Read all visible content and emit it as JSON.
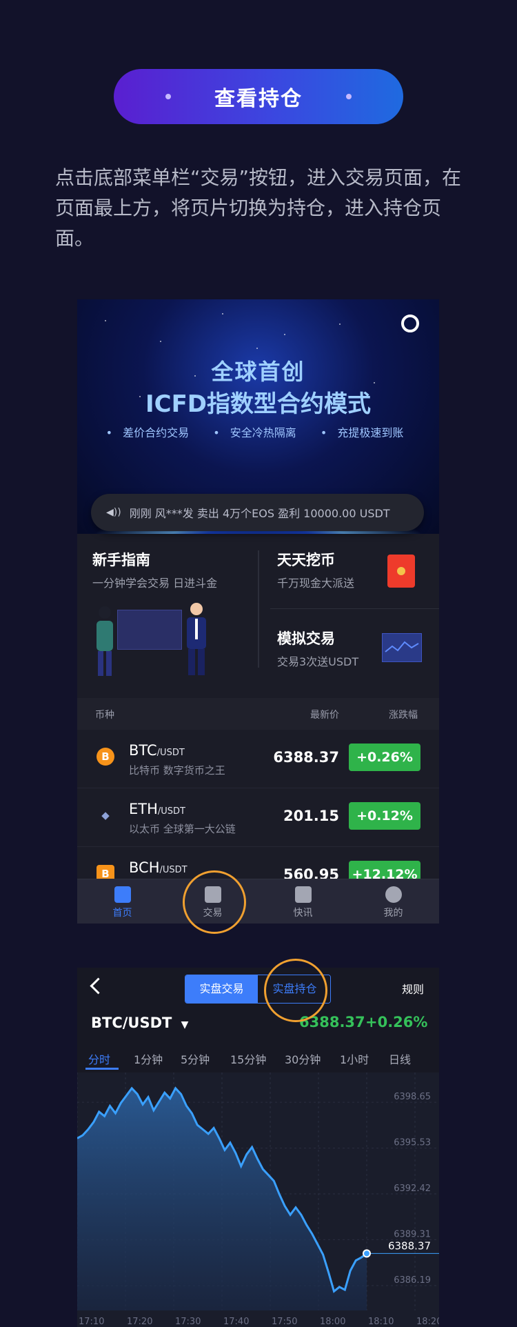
{
  "header": {
    "title": "查看持仓"
  },
  "intro": {
    "text": "点击底部菜单栏“交易”按钮，进入交易页面，在页面最上方，将页片切换为持仓，进入持仓页面。"
  },
  "home": {
    "banner": {
      "title_line1": "全球首创",
      "title_line2": "ICFD指数型合约模式",
      "features": [
        "差价合约交易",
        "安全冷热隔离",
        "充提极速到账"
      ]
    },
    "ticker": {
      "text": "刚刚  风***发 卖出 4万个EOS  盈利 10000.00 USDT"
    },
    "cards": {
      "guide": {
        "title": "新手指南",
        "subtitle": "一分钟学会交易 日进斗金"
      },
      "mining": {
        "title": "天天挖币",
        "subtitle": "千万现金大派送"
      },
      "sim": {
        "title": "模拟交易",
        "subtitle": "交易3次送USDT"
      }
    },
    "market": {
      "headers": {
        "coin": "币种",
        "price": "最新价",
        "change": "涨跌幅"
      },
      "rows": [
        {
          "symbol": "BTC",
          "quote": "/USDT",
          "desc": "比特币 数字货币之王",
          "price": "6388.37",
          "change": "+0.26%"
        },
        {
          "symbol": "ETH",
          "quote": "/USDT",
          "desc": "以太币 全球第一大公链",
          "price": "201.15",
          "change": "+0.12%"
        },
        {
          "symbol": "BCH",
          "quote": "/USDT",
          "desc": "",
          "price": "560.95",
          "change": "+12.12%"
        }
      ]
    },
    "tabs": [
      "首页",
      "交易",
      "快讯",
      "我的"
    ]
  },
  "trade": {
    "segments": {
      "real_trade": "实盘交易",
      "real_position": "实盘持仓"
    },
    "rules": "规则",
    "pair": "BTC/USDT",
    "pair_arrow": "▼",
    "price": "6388.37",
    "change": "+0.26%",
    "intervals": [
      "分时",
      "1分钟",
      "5分钟",
      "15分钟",
      "30分钟",
      "1小时",
      "日线"
    ],
    "active_interval": "分时"
  },
  "chart_data": {
    "type": "area",
    "title": "",
    "xlabel": "",
    "ylabel": "",
    "x_ticks": [
      "17:10",
      "17:20",
      "17:30",
      "17:40",
      "17:50",
      "18:00",
      "18:10",
      "18:20"
    ],
    "y_ticks": [
      "6398.65",
      "6395.53",
      "6392.42",
      "6389.31",
      "6386.19"
    ],
    "ylim": [
      6384.5,
      6400.2
    ],
    "current_label": "6388.37",
    "series": [
      {
        "values": [
          6396.2,
          6396.4,
          6396.8,
          6397.3,
          6398.0,
          6397.7,
          6398.4,
          6397.9,
          6398.6,
          6399.1,
          6399.6,
          6399.2,
          6398.5,
          6399.0,
          6398.1,
          6398.7,
          6399.3,
          6398.9,
          6399.6,
          6399.2,
          6398.4,
          6397.9,
          6397.1,
          6396.8,
          6396.5,
          6396.9,
          6396.2,
          6395.4,
          6395.9,
          6395.2,
          6394.3,
          6395.1,
          6395.6,
          6394.8,
          6394.1,
          6393.7,
          6393.3,
          6392.4,
          6391.6,
          6391.0,
          6391.5,
          6391.0,
          6390.3,
          6389.7,
          6389.0,
          6388.3,
          6387.1,
          6385.8,
          6386.1,
          6385.9,
          6387.2,
          6387.9,
          6388.1,
          6388.37
        ]
      }
    ]
  },
  "colors": {
    "accent": "#3d7dfa",
    "up": "#2fb34a",
    "highlight_ring": "#f0a030"
  }
}
